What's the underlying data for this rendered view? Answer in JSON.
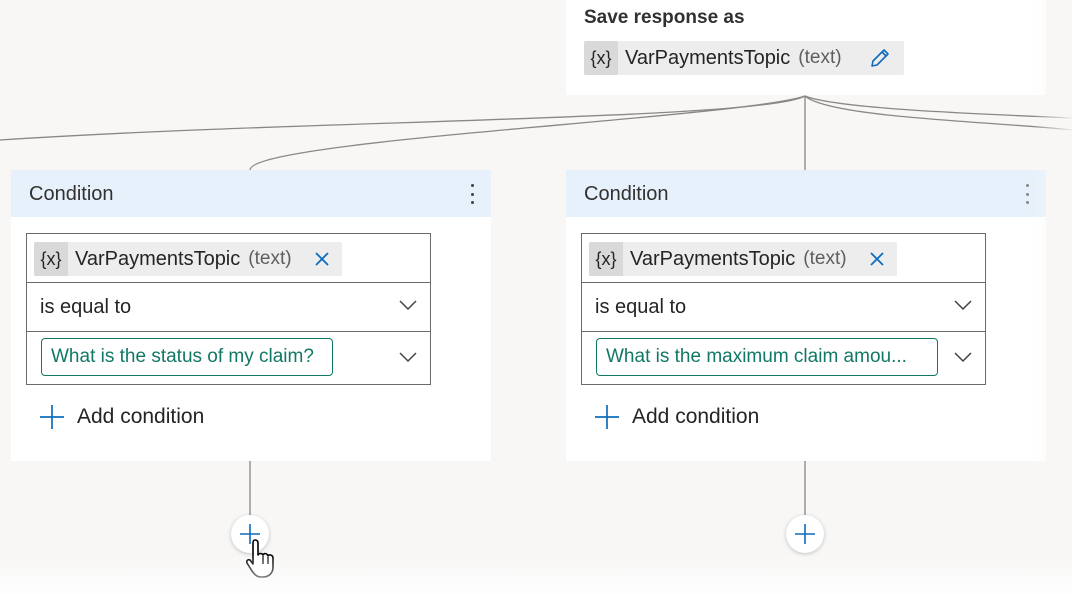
{
  "save_response": {
    "title": "Save response as",
    "variable_badge": "{x}",
    "variable_name": "VarPaymentsTopic",
    "variable_type": "(text)",
    "edit_icon": "pencil-icon"
  },
  "conditions": [
    {
      "title": "Condition",
      "more_icon": "more-vertical-icon",
      "variable_badge": "{x}",
      "variable_name": "VarPaymentsTopic",
      "variable_type": "(text)",
      "remove_icon": "close-icon",
      "operator": "is equal to",
      "value": "What is the status of my claim?",
      "add_condition_label": "Add condition"
    },
    {
      "title": "Condition",
      "more_icon": "more-vertical-icon",
      "variable_badge": "{x}",
      "variable_name": "VarPaymentsTopic",
      "variable_type": "(text)",
      "remove_icon": "close-icon",
      "operator": "is equal to",
      "value": "What is the maximum claim amou...",
      "add_condition_label": "Add condition"
    }
  ],
  "colors": {
    "canvas_background": "#f8f7f6",
    "card_background": "#ffffff",
    "header_background": "#e6f1fb",
    "accent_teal": "#117865",
    "connector_line": "#8a8886",
    "chip_background": "#ededed"
  }
}
